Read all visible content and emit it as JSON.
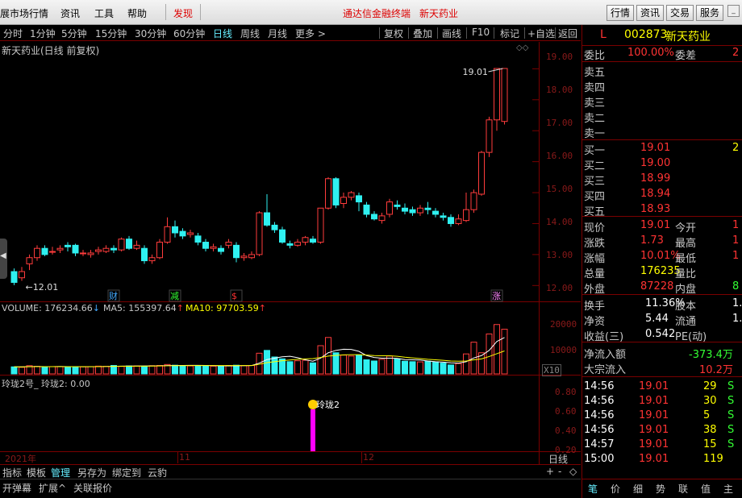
{
  "menubar": {
    "items": [
      "展市场行情",
      "资讯",
      "工具",
      "帮助",
      "发现"
    ],
    "center_title": "通达信金融终端",
    "center_stock": "新天药业",
    "right_buttons": [
      "行情",
      "资讯",
      "交易",
      "服务"
    ]
  },
  "toolbar": {
    "periods": [
      "分时",
      "1分钟",
      "5分钟",
      "15分钟",
      "30分钟",
      "60分钟",
      "日线",
      "周线",
      "月线",
      "更多 >"
    ],
    "active_period": "日线",
    "tools": [
      "复权",
      "叠加",
      "画线",
      "F10",
      "标记",
      "+自选",
      "返回"
    ]
  },
  "main_chart": {
    "title": "新天药业(日线 前复权)",
    "high_label": "19.01",
    "low_label": "12.01",
    "price_axis": [
      "19.00",
      "18.00",
      "17.00",
      "16.00",
      "15.00",
      "14.00",
      "13.00",
      "12.00"
    ],
    "markers": [
      "财",
      "减",
      "$",
      "涨"
    ],
    "marker_colors": [
      "#4af",
      "#3f3",
      "#f33",
      "#f8f"
    ]
  },
  "volume": {
    "label": "VOLUME: 176234.66",
    "ma5": "MA5: 155397.64",
    "ma10": "MA10: 97703.59",
    "axis": [
      "20000",
      "10000"
    ],
    "multiplier": "X10"
  },
  "indicator": {
    "label": "玲珑2号_  玲珑2: 0.00",
    "axis": [
      "0.80",
      "0.60",
      "0.40",
      "0.20"
    ],
    "signal_label": "玲珑2"
  },
  "time_axis": {
    "labels": [
      "2021年",
      "11",
      "12"
    ],
    "period_label": "日线"
  },
  "bottom_tabs": [
    "指标",
    "模板",
    "管理",
    "另存为",
    "绑定到",
    "云豹"
  ],
  "bottom_tabs_active": "管理",
  "bottom_bar2": [
    "开弹幕",
    "扩展^",
    "关联报价"
  ],
  "bottom_ctrl": [
    "+",
    "-",
    "◇"
  ],
  "quote": {
    "flag": "L",
    "code": "002873",
    "name": "新天药业",
    "webi_label": "委比",
    "webi_value": "100.00%",
    "weicha_label": "委差",
    "weicha_value": "2",
    "sells": [
      {
        "label": "卖五",
        "price": "",
        "vol": ""
      },
      {
        "label": "卖四",
        "price": "",
        "vol": ""
      },
      {
        "label": "卖三",
        "price": "",
        "vol": ""
      },
      {
        "label": "卖二",
        "price": "",
        "vol": ""
      },
      {
        "label": "卖一",
        "price": "",
        "vol": ""
      }
    ],
    "buys": [
      {
        "label": "买一",
        "price": "19.01",
        "vol": "2"
      },
      {
        "label": "买二",
        "price": "19.00",
        "vol": ""
      },
      {
        "label": "买三",
        "price": "18.99",
        "vol": ""
      },
      {
        "label": "买四",
        "price": "18.94",
        "vol": ""
      },
      {
        "label": "买五",
        "price": "18.93",
        "vol": ""
      }
    ],
    "stats": [
      {
        "l1": "现价",
        "v1": "19.01",
        "l2": "今开",
        "v2": "1"
      },
      {
        "l1": "涨跌",
        "v1": "1.73",
        "l2": "最高",
        "v2": "1"
      },
      {
        "l1": "涨幅",
        "v1": "10.01%",
        "l2": "最低",
        "v2": "1"
      },
      {
        "l1": "总量",
        "v1": "176235",
        "l2": "量比",
        "v2": ""
      },
      {
        "l1": "外盘",
        "v1": "87228",
        "l2": "内盘",
        "v2": "8"
      }
    ],
    "stats2": [
      {
        "l1": "换手",
        "v1": "11.36%",
        "l2": "股本",
        "v2": "1."
      },
      {
        "l1": "净资",
        "v1": "5.44",
        "l2": "流通",
        "v2": "1."
      },
      {
        "l1": "收益(三)",
        "v1": "0.542",
        "l2": "PE(动)",
        "v2": ""
      }
    ],
    "netflow_label": "净流入额",
    "netflow_value": "-373.4万",
    "bigflow_label": "大宗流入",
    "bigflow_value": "10.2万",
    "ticks": [
      {
        "time": "14:56",
        "price": "19.01",
        "vol": "29",
        "side": "S"
      },
      {
        "time": "14:56",
        "price": "19.01",
        "vol": "30",
        "side": "S"
      },
      {
        "time": "14:56",
        "price": "19.01",
        "vol": "5",
        "side": "S"
      },
      {
        "time": "14:56",
        "price": "19.01",
        "vol": "38",
        "side": "S"
      },
      {
        "time": "14:57",
        "price": "19.01",
        "vol": "15",
        "side": "S"
      },
      {
        "time": "15:00",
        "price": "19.01",
        "vol": "119",
        "side": ""
      }
    ],
    "tabs": [
      "笔",
      "价",
      "细",
      "势",
      "联",
      "值",
      "主"
    ],
    "active_tab": "笔"
  },
  "chart_data": {
    "type": "candlestick",
    "title": "新天药业(日线 前复权)",
    "ylim": [
      11.8,
      19.4
    ],
    "candles": [
      {
        "o": 12.45,
        "c": 12.1,
        "h": 12.55,
        "l": 12.01
      },
      {
        "o": 12.25,
        "c": 12.45,
        "h": 12.6,
        "l": 12.15
      },
      {
        "o": 12.7,
        "c": 12.9,
        "h": 13.0,
        "l": 12.5
      },
      {
        "o": 12.9,
        "c": 13.2,
        "h": 13.3,
        "l": 12.8
      },
      {
        "o": 13.2,
        "c": 13.0,
        "h": 13.3,
        "l": 12.95
      },
      {
        "o": 13.1,
        "c": 13.1,
        "h": 13.25,
        "l": 13.0
      },
      {
        "o": 13.15,
        "c": 13.2,
        "h": 13.3,
        "l": 13.05
      },
      {
        "o": 13.3,
        "c": 13.25,
        "h": 13.4,
        "l": 13.1
      },
      {
        "o": 13.3,
        "c": 13.05,
        "h": 13.35,
        "l": 12.95
      },
      {
        "o": 13.05,
        "c": 13.05,
        "h": 13.15,
        "l": 12.95
      },
      {
        "o": 13.0,
        "c": 13.05,
        "h": 13.15,
        "l": 12.9
      },
      {
        "o": 13.1,
        "c": 13.15,
        "h": 13.25,
        "l": 13.0
      },
      {
        "o": 13.1,
        "c": 13.2,
        "h": 13.3,
        "l": 13.05
      },
      {
        "o": 13.2,
        "c": 13.15,
        "h": 13.3,
        "l": 13.05
      },
      {
        "o": 13.15,
        "c": 13.5,
        "h": 13.55,
        "l": 13.1
      },
      {
        "o": 13.5,
        "c": 13.2,
        "h": 13.6,
        "l": 13.15
      },
      {
        "o": 13.2,
        "c": 13.3,
        "h": 13.45,
        "l": 13.15
      },
      {
        "o": 13.2,
        "c": 12.8,
        "h": 13.3,
        "l": 12.7
      },
      {
        "o": 12.8,
        "c": 12.9,
        "h": 13.0,
        "l": 12.7
      },
      {
        "o": 12.9,
        "c": 13.4,
        "h": 13.5,
        "l": 12.85
      },
      {
        "o": 13.4,
        "c": 13.9,
        "h": 14.2,
        "l": 13.35
      },
      {
        "o": 13.9,
        "c": 13.7,
        "h": 14.1,
        "l": 13.55
      },
      {
        "o": 13.75,
        "c": 13.6,
        "h": 13.85,
        "l": 13.5
      },
      {
        "o": 13.65,
        "c": 13.7,
        "h": 13.8,
        "l": 13.55
      },
      {
        "o": 13.6,
        "c": 13.4,
        "h": 13.7,
        "l": 13.3
      },
      {
        "o": 13.4,
        "c": 13.2,
        "h": 13.5,
        "l": 13.1
      },
      {
        "o": 13.2,
        "c": 13.25,
        "h": 13.35,
        "l": 13.1
      },
      {
        "o": 13.2,
        "c": 13.1,
        "h": 13.3,
        "l": 13.0
      },
      {
        "o": 13.3,
        "c": 13.4,
        "h": 13.5,
        "l": 13.2
      },
      {
        "o": 13.3,
        "c": 12.9,
        "h": 13.4,
        "l": 12.75
      },
      {
        "o": 12.9,
        "c": 12.95,
        "h": 13.05,
        "l": 12.8
      },
      {
        "o": 12.9,
        "c": 13.0,
        "h": 13.1,
        "l": 12.85
      },
      {
        "o": 13.0,
        "c": 14.35,
        "h": 14.4,
        "l": 12.95
      },
      {
        "o": 14.35,
        "c": 13.95,
        "h": 14.95,
        "l": 13.9
      },
      {
        "o": 13.95,
        "c": 13.8,
        "h": 14.05,
        "l": 13.7
      },
      {
        "o": 13.8,
        "c": 13.4,
        "h": 13.9,
        "l": 13.35
      },
      {
        "o": 13.35,
        "c": 13.3,
        "h": 13.45,
        "l": 13.2
      },
      {
        "o": 13.3,
        "c": 13.4,
        "h": 13.5,
        "l": 13.25
      },
      {
        "o": 13.4,
        "c": 13.55,
        "h": 13.6,
        "l": 13.3
      },
      {
        "o": 13.5,
        "c": 13.4,
        "h": 13.6,
        "l": 13.35
      },
      {
        "o": 13.4,
        "c": 14.5,
        "h": 14.5,
        "l": 13.35
      },
      {
        "o": 14.5,
        "c": 15.45,
        "h": 15.5,
        "l": 14.45
      },
      {
        "o": 15.45,
        "c": 14.6,
        "h": 15.5,
        "l": 14.5
      },
      {
        "o": 14.65,
        "c": 14.85,
        "h": 15.0,
        "l": 14.5
      },
      {
        "o": 14.85,
        "c": 15.0,
        "h": 15.05,
        "l": 14.75
      },
      {
        "o": 14.9,
        "c": 14.7,
        "h": 15.0,
        "l": 14.4
      },
      {
        "o": 14.6,
        "c": 14.3,
        "h": 14.7,
        "l": 14.2
      },
      {
        "o": 14.3,
        "c": 14.15,
        "h": 14.4,
        "l": 14.1
      },
      {
        "o": 14.1,
        "c": 14.25,
        "h": 14.35,
        "l": 14.0
      },
      {
        "o": 14.3,
        "c": 14.7,
        "h": 14.8,
        "l": 14.2
      },
      {
        "o": 14.6,
        "c": 14.55,
        "h": 14.75,
        "l": 14.45
      },
      {
        "o": 14.5,
        "c": 14.4,
        "h": 14.65,
        "l": 14.3
      },
      {
        "o": 14.45,
        "c": 14.35,
        "h": 14.55,
        "l": 14.25
      },
      {
        "o": 14.35,
        "c": 14.5,
        "h": 14.6,
        "l": 14.25
      },
      {
        "o": 14.5,
        "c": 14.45,
        "h": 14.7,
        "l": 14.3
      },
      {
        "o": 14.4,
        "c": 14.3,
        "h": 14.5,
        "l": 14.2
      },
      {
        "o": 14.25,
        "c": 14.2,
        "h": 14.35,
        "l": 14.1
      },
      {
        "o": 14.2,
        "c": 14.0,
        "h": 14.3,
        "l": 13.9
      },
      {
        "o": 14.0,
        "c": 14.15,
        "h": 14.3,
        "l": 13.95
      },
      {
        "o": 14.1,
        "c": 14.45,
        "h": 15.0,
        "l": 14.05
      },
      {
        "o": 14.45,
        "c": 15.0,
        "h": 15.1,
        "l": 14.35
      },
      {
        "o": 14.95,
        "c": 16.3,
        "h": 16.35,
        "l": 14.9
      },
      {
        "o": 16.3,
        "c": 17.35,
        "h": 17.45,
        "l": 16.15
      },
      {
        "o": 17.35,
        "c": 19.01,
        "h": 19.01,
        "l": 17.0
      },
      {
        "o": 17.3,
        "c": 19.01,
        "h": 19.01,
        "l": 17.2
      }
    ],
    "volume": [
      3000,
      2800,
      3500,
      3200,
      3000,
      3100,
      3100,
      3000,
      2900,
      3000,
      3100,
      3300,
      3200,
      3600,
      3200,
      3400,
      3400,
      3300,
      3500,
      3600,
      4000,
      3700,
      3500,
      3400,
      3600,
      3300,
      3300,
      3400,
      3600,
      3700,
      3500,
      3600,
      8800,
      10000,
      7200,
      6400,
      5200,
      5600,
      5800,
      4700,
      12000,
      15500,
      9000,
      8000,
      7600,
      8000,
      6000,
      5500,
      6200,
      7600,
      6400,
      5400,
      5200,
      5100,
      5400,
      5000,
      4600,
      3800,
      4400,
      8500,
      13500,
      9000,
      17000,
      21000,
      19000
    ],
    "ma5": [
      3000,
      3000,
      3100,
      3150,
      3100,
      3100,
      3150,
      3100,
      3100,
      3050,
      3050,
      3100,
      3150,
      3200,
      3300,
      3350,
      3350,
      3400,
      3400,
      3450,
      3550,
      3600,
      3600,
      3650,
      3650,
      3600,
      3500,
      3450,
      3400,
      3450,
      3500,
      3550,
      4600,
      6100,
      6700,
      7300,
      7500,
      6900,
      6000,
      5400,
      6700,
      9000,
      10000,
      10500,
      10400,
      9600,
      7800,
      7000,
      6700,
      6700,
      6600,
      6100,
      6000,
      5900,
      5500,
      5200,
      5000,
      4700,
      4600,
      5200,
      6800,
      7800,
      10000,
      13800,
      15500
    ],
    "ma10": [
      3000,
      3000,
      3050,
      3100,
      3100,
      3100,
      3100,
      3100,
      3100,
      3100,
      3100,
      3100,
      3150,
      3200,
      3250,
      3250,
      3300,
      3300,
      3350,
      3400,
      3450,
      3500,
      3500,
      3550,
      3550,
      3550,
      3550,
      3550,
      3550,
      3550,
      3550,
      3550,
      4100,
      4800,
      5200,
      5600,
      5900,
      6200,
      6400,
      6500,
      7000,
      7600,
      7900,
      8100,
      8200,
      8200,
      8000,
      7800,
      7700,
      7700,
      7500,
      7100,
      6800,
      6500,
      6200,
      6000,
      5800,
      5500,
      5400,
      5500,
      6000,
      6400,
      7400,
      8600,
      9770
    ]
  }
}
